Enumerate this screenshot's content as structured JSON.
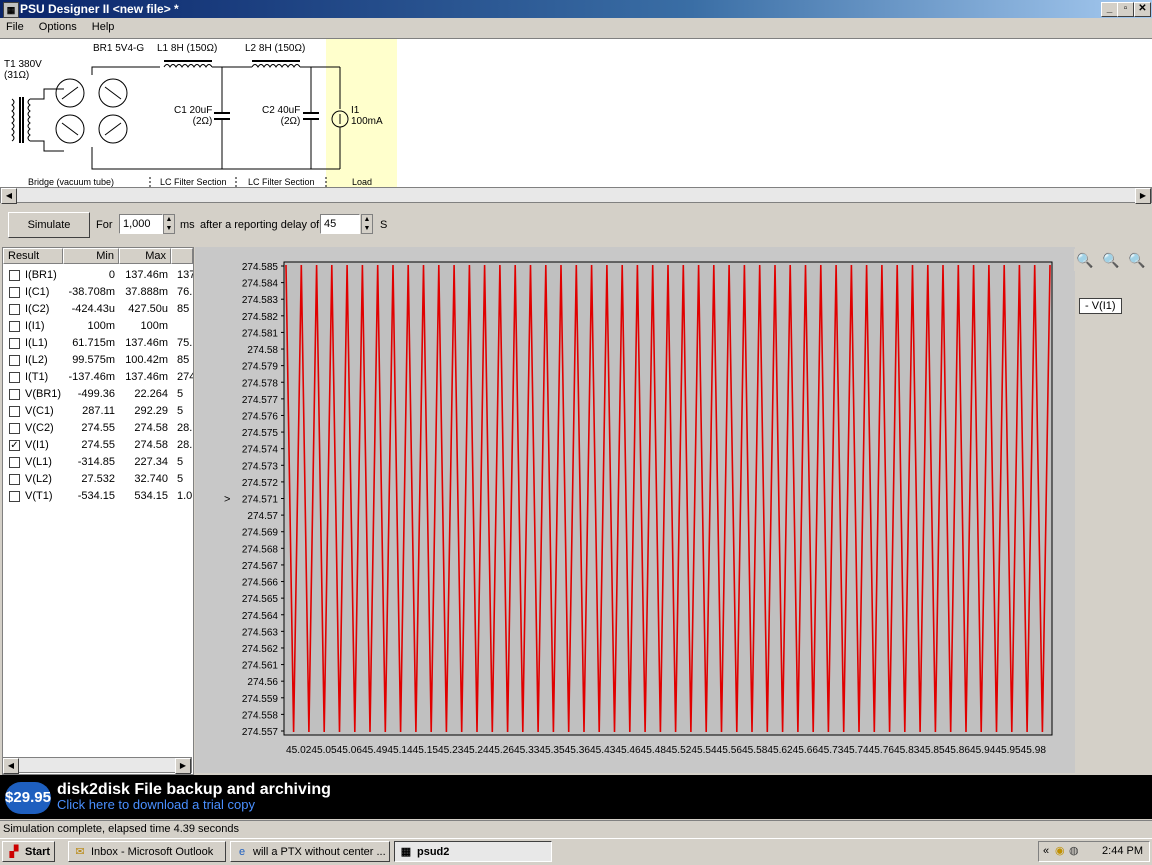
{
  "window": {
    "title": "PSU Designer II  <new file> *",
    "min": "_",
    "max": "▫",
    "close": "✕"
  },
  "menu": [
    "File",
    "Options",
    "Help"
  ],
  "schematic": {
    "t1": "T1 380V\n(31Ω)",
    "br1": "BR1 5V4-G",
    "l1": "L1 8H (150Ω)",
    "l2": "L2 8H (150Ω)",
    "c1": "C1 20uF\n(2Ω)",
    "c2": "C2 40uF\n(2Ω)",
    "i1": "I1\n100mA",
    "sec_bridge": "Bridge (vacuum tube)",
    "sec_lc1": "LC Filter Section",
    "sec_lc2": "LC Filter Section",
    "sec_load": "Load"
  },
  "sim": {
    "button": "Simulate",
    "for": "For",
    "duration": "1,000",
    "ms": "ms",
    "after": "after a reporting delay of",
    "delay": "45",
    "s": "S"
  },
  "results": {
    "headers": [
      "Result",
      "Min",
      "Max"
    ],
    "rows": [
      {
        "name": "I(BR1)",
        "min": "0",
        "max": "137.46m",
        "extra": "137",
        "checked": false
      },
      {
        "name": "I(C1)",
        "min": "-38.708m",
        "max": "37.888m",
        "extra": "76.",
        "checked": false
      },
      {
        "name": "I(C2)",
        "min": "-424.43u",
        "max": "427.50u",
        "extra": "85",
        "checked": false
      },
      {
        "name": "I(I1)",
        "min": "100m",
        "max": "100m",
        "extra": "",
        "checked": false
      },
      {
        "name": "I(L1)",
        "min": "61.715m",
        "max": "137.46m",
        "extra": "75.",
        "checked": false
      },
      {
        "name": "I(L2)",
        "min": "99.575m",
        "max": "100.42m",
        "extra": "85",
        "checked": false
      },
      {
        "name": "I(T1)",
        "min": "-137.46m",
        "max": "137.46m",
        "extra": "274",
        "checked": false
      },
      {
        "name": "V(BR1)",
        "min": "-499.36",
        "max": "22.264",
        "extra": "5",
        "checked": false
      },
      {
        "name": "V(C1)",
        "min": "287.11",
        "max": "292.29",
        "extra": "5",
        "checked": false
      },
      {
        "name": "V(C2)",
        "min": "274.55",
        "max": "274.58",
        "extra": "28.",
        "checked": false
      },
      {
        "name": "V(I1)",
        "min": "274.55",
        "max": "274.58",
        "extra": "28.",
        "checked": true
      },
      {
        "name": "V(L1)",
        "min": "-314.85",
        "max": "227.34",
        "extra": "5",
        "checked": false
      },
      {
        "name": "V(L2)",
        "min": "27.532",
        "max": "32.740",
        "extra": "5",
        "checked": false
      },
      {
        "name": "V(T1)",
        "min": "-534.15",
        "max": "534.15",
        "extra": "1.0",
        "checked": false
      }
    ]
  },
  "chart_data": {
    "type": "line",
    "series": [
      {
        "name": "- V(I1)",
        "color": "#e00000"
      }
    ],
    "y_ticks": [
      "274.585",
      "274.584",
      "274.583",
      "274.582",
      "274.581",
      "274.58",
      "274.579",
      "274.578",
      "274.577",
      "274.576",
      "274.575",
      "274.574",
      "274.573",
      "274.572",
      "274.571",
      "274.57",
      "274.569",
      "274.568",
      "274.567",
      "274.566",
      "274.565",
      "274.564",
      "274.563",
      "274.562",
      "274.561",
      "274.56",
      "274.559",
      "274.558",
      "274.557"
    ],
    "ylim": [
      274.557,
      274.585
    ],
    "xlim": [
      45.02,
      45.98
    ],
    "x_tick_text": "45.0245.0545.0645.4945.1445.1545.2345.2445.2645.3345.3545.3645.4345.4645.4845.5245.5445.5645.5845.6245.6645.7345.7445.7645.8345.8545.8645.9445.9545.98",
    "marker": ">",
    "cycles": 50,
    "grid": false
  },
  "zoom": {
    "in": "zoom-in-icon",
    "out": "zoom-out-icon",
    "reset": "zoom-reset-icon"
  },
  "ad": {
    "price": "$29.95",
    "headline": "disk2disk File backup and archiving",
    "sub": "Click here to download a trial copy"
  },
  "status": "Simulation complete, elapsed time 4.39 seconds",
  "taskbar": {
    "start": "Start",
    "items": [
      {
        "label": "Inbox - Microsoft Outlook",
        "active": false
      },
      {
        "label": "will a PTX without center ...",
        "active": false
      },
      {
        "label": "psud2",
        "active": true
      }
    ],
    "clock": "2:44 PM",
    "tray_arrow": "«"
  }
}
